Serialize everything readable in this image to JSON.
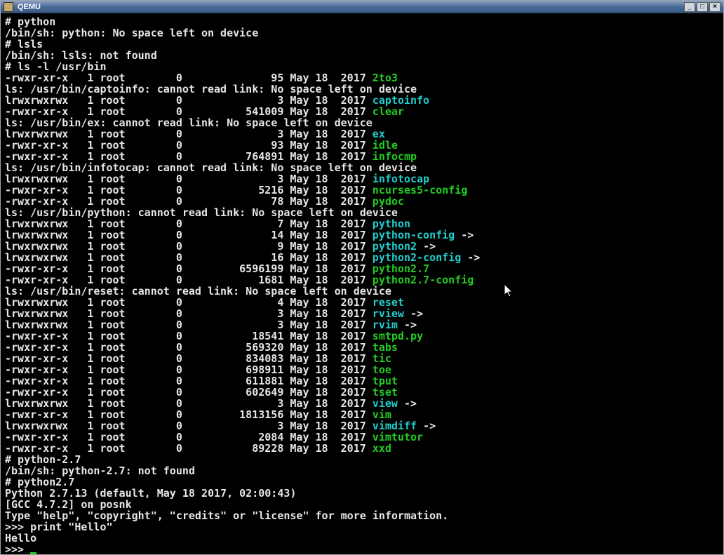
{
  "window": {
    "title": "QEMU"
  },
  "header_lines": [
    "# python",
    "/bin/sh: python: No space left on device",
    "# lsls",
    "/bin/sh: lsls: not found",
    "# ls -l /usr/bin"
  ],
  "listing": [
    {
      "perm": "-rwxr-xr-x",
      "links": "1",
      "owner": "root",
      "group": "0",
      "size": "95",
      "date": "May 18  2017",
      "name": "2to3",
      "color": "g",
      "suffix": ""
    },
    {
      "msg": "ls: /usr/bin/captoinfo: cannot read link: No space left on device"
    },
    {
      "perm": "lrwxrwxrwx",
      "links": "1",
      "owner": "root",
      "group": "0",
      "size": "3",
      "date": "May 18  2017",
      "name": "captoinfo",
      "color": "c",
      "suffix": ""
    },
    {
      "perm": "-rwxr-xr-x",
      "links": "1",
      "owner": "root",
      "group": "0",
      "size": "541009",
      "date": "May 18  2017",
      "name": "clear",
      "color": "g",
      "suffix": ""
    },
    {
      "msg": "ls: /usr/bin/ex: cannot read link: No space left on device"
    },
    {
      "perm": "lrwxrwxrwx",
      "links": "1",
      "owner": "root",
      "group": "0",
      "size": "3",
      "date": "May 18  2017",
      "name": "ex",
      "color": "c",
      "suffix": ""
    },
    {
      "perm": "-rwxr-xr-x",
      "links": "1",
      "owner": "root",
      "group": "0",
      "size": "93",
      "date": "May 18  2017",
      "name": "idle",
      "color": "g",
      "suffix": ""
    },
    {
      "perm": "-rwxr-xr-x",
      "links": "1",
      "owner": "root",
      "group": "0",
      "size": "764891",
      "date": "May 18  2017",
      "name": "infocmp",
      "color": "g",
      "suffix": ""
    },
    {
      "msg": "ls: /usr/bin/infotocap: cannot read link: No space left on device"
    },
    {
      "perm": "lrwxrwxrwx",
      "links": "1",
      "owner": "root",
      "group": "0",
      "size": "3",
      "date": "May 18  2017",
      "name": "infotocap",
      "color": "c",
      "suffix": ""
    },
    {
      "perm": "-rwxr-xr-x",
      "links": "1",
      "owner": "root",
      "group": "0",
      "size": "5216",
      "date": "May 18  2017",
      "name": "ncurses5-config",
      "color": "g",
      "suffix": ""
    },
    {
      "perm": "-rwxr-xr-x",
      "links": "1",
      "owner": "root",
      "group": "0",
      "size": "78",
      "date": "May 18  2017",
      "name": "pydoc",
      "color": "g",
      "suffix": ""
    },
    {
      "msg": "ls: /usr/bin/python: cannot read link: No space left on device"
    },
    {
      "perm": "lrwxrwxrwx",
      "links": "1",
      "owner": "root",
      "group": "0",
      "size": "7",
      "date": "May 18  2017",
      "name": "python",
      "color": "c",
      "suffix": ""
    },
    {
      "perm": "lrwxrwxrwx",
      "links": "1",
      "owner": "root",
      "group": "0",
      "size": "14",
      "date": "May 18  2017",
      "name": "python-config",
      "color": "c",
      "suffix": " ->"
    },
    {
      "perm": "lrwxrwxrwx",
      "links": "1",
      "owner": "root",
      "group": "0",
      "size": "9",
      "date": "May 18  2017",
      "name": "python2",
      "color": "c",
      "suffix": " ->"
    },
    {
      "perm": "lrwxrwxrwx",
      "links": "1",
      "owner": "root",
      "group": "0",
      "size": "16",
      "date": "May 18  2017",
      "name": "python2-config",
      "color": "c",
      "suffix": " ->"
    },
    {
      "perm": "-rwxr-xr-x",
      "links": "1",
      "owner": "root",
      "group": "0",
      "size": "6596199",
      "date": "May 18  2017",
      "name": "python2.7",
      "color": "g",
      "suffix": ""
    },
    {
      "perm": "-rwxr-xr-x",
      "links": "1",
      "owner": "root",
      "group": "0",
      "size": "1681",
      "date": "May 18  2017",
      "name": "python2.7-config",
      "color": "g",
      "suffix": ""
    },
    {
      "msg": "ls: /usr/bin/reset: cannot read link: No space left on device"
    },
    {
      "perm": "lrwxrwxrwx",
      "links": "1",
      "owner": "root",
      "group": "0",
      "size": "4",
      "date": "May 18  2017",
      "name": "reset",
      "color": "c",
      "suffix": ""
    },
    {
      "perm": "lrwxrwxrwx",
      "links": "1",
      "owner": "root",
      "group": "0",
      "size": "3",
      "date": "May 18  2017",
      "name": "rview",
      "color": "c",
      "suffix": " ->"
    },
    {
      "perm": "lrwxrwxrwx",
      "links": "1",
      "owner": "root",
      "group": "0",
      "size": "3",
      "date": "May 18  2017",
      "name": "rvim",
      "color": "c",
      "suffix": " ->"
    },
    {
      "perm": "-rwxr-xr-x",
      "links": "1",
      "owner": "root",
      "group": "0",
      "size": "18541",
      "date": "May 18  2017",
      "name": "smtpd.py",
      "color": "g",
      "suffix": ""
    },
    {
      "perm": "-rwxr-xr-x",
      "links": "1",
      "owner": "root",
      "group": "0",
      "size": "569320",
      "date": "May 18  2017",
      "name": "tabs",
      "color": "g",
      "suffix": ""
    },
    {
      "perm": "-rwxr-xr-x",
      "links": "1",
      "owner": "root",
      "group": "0",
      "size": "834083",
      "date": "May 18  2017",
      "name": "tic",
      "color": "g",
      "suffix": ""
    },
    {
      "perm": "-rwxr-xr-x",
      "links": "1",
      "owner": "root",
      "group": "0",
      "size": "698911",
      "date": "May 18  2017",
      "name": "toe",
      "color": "g",
      "suffix": ""
    },
    {
      "perm": "-rwxr-xr-x",
      "links": "1",
      "owner": "root",
      "group": "0",
      "size": "611881",
      "date": "May 18  2017",
      "name": "tput",
      "color": "g",
      "suffix": ""
    },
    {
      "perm": "-rwxr-xr-x",
      "links": "1",
      "owner": "root",
      "group": "0",
      "size": "602649",
      "date": "May 18  2017",
      "name": "tset",
      "color": "g",
      "suffix": ""
    },
    {
      "perm": "lrwxrwxrwx",
      "links": "1",
      "owner": "root",
      "group": "0",
      "size": "3",
      "date": "May 18  2017",
      "name": "view",
      "color": "c",
      "suffix": " ->"
    },
    {
      "perm": "-rwxr-xr-x",
      "links": "1",
      "owner": "root",
      "group": "0",
      "size": "1813156",
      "date": "May 18  2017",
      "name": "vim",
      "color": "g",
      "suffix": ""
    },
    {
      "perm": "lrwxrwxrwx",
      "links": "1",
      "owner": "root",
      "group": "0",
      "size": "3",
      "date": "May 18  2017",
      "name": "vimdiff",
      "color": "c",
      "suffix": " ->"
    },
    {
      "perm": "-rwxr-xr-x",
      "links": "1",
      "owner": "root",
      "group": "0",
      "size": "2084",
      "date": "May 18  2017",
      "name": "vimtutor",
      "color": "g",
      "suffix": ""
    },
    {
      "perm": "-rwxr-xr-x",
      "links": "1",
      "owner": "root",
      "group": "0",
      "size": "89228",
      "date": "May 18  2017",
      "name": "xxd",
      "color": "g",
      "suffix": ""
    }
  ],
  "footer_lines": [
    "# python-2.7",
    "/bin/sh: python-2.7: not found",
    "# python2.7",
    "Python 2.7.13 (default, May 18 2017, 02:00:43)",
    "[GCC 4.7.2] on posnk",
    "Type \"help\", \"copyright\", \"credits\" or \"license\" for more information.",
    ">>> print \"Hello\"",
    "Hello",
    ">>> "
  ]
}
